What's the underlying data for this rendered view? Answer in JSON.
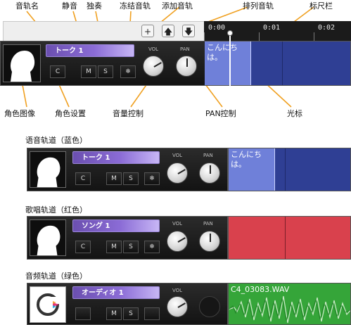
{
  "callouts": {
    "track_name": "音轨名",
    "mute": "静音",
    "solo": "独奏",
    "freeze": "冻结音轨",
    "add_track": "添加音轨",
    "arrange_track": "排列音轨",
    "ruler": "标尺栏",
    "avatar": "角色图像",
    "character_settings": "角色设置",
    "volume_control": "音量控制",
    "pan_control": "PAN控制",
    "cursor": "光标"
  },
  "toolbar": {
    "add_icon": "+",
    "up_icon": "🡅",
    "down_icon": "🡇"
  },
  "ruler": {
    "ticks": [
      "0:00",
      "0:01",
      "0:02"
    ]
  },
  "section_labels": {
    "talk": "语音轨道（蓝色）",
    "song": "歌唱轨道（红色）",
    "audio": "音频轨道（绿色）"
  },
  "tracks": {
    "top": {
      "name": "トーク 1",
      "clip_text": "こんにちは。",
      "c": "C",
      "m": "M",
      "s": "S",
      "freeze": "❄",
      "vol_label": "VOL",
      "pan_label": "PAN"
    },
    "talk": {
      "name": "トーク 1",
      "clip_text": "こんにちは。",
      "c": "C",
      "m": "M",
      "s": "S",
      "freeze": "❄",
      "vol_label": "VOL",
      "pan_label": "PAN"
    },
    "song": {
      "name": "ソング 1",
      "c": "C",
      "m": "M",
      "s": "S",
      "freeze": "❄",
      "vol_label": "VOL",
      "pan_label": "PAN"
    },
    "audio": {
      "name": "オーディオ 1",
      "clip_text": "C4_03083.WAV",
      "m": "M",
      "s": "S",
      "vol_label": "VOL"
    }
  },
  "colors": {
    "talk_clip": "#6f80d9",
    "talk_lane": "#2f3f94",
    "song_lane": "#d9414d",
    "audio_lane": "#35a539",
    "callout_line": "#f0a020"
  }
}
